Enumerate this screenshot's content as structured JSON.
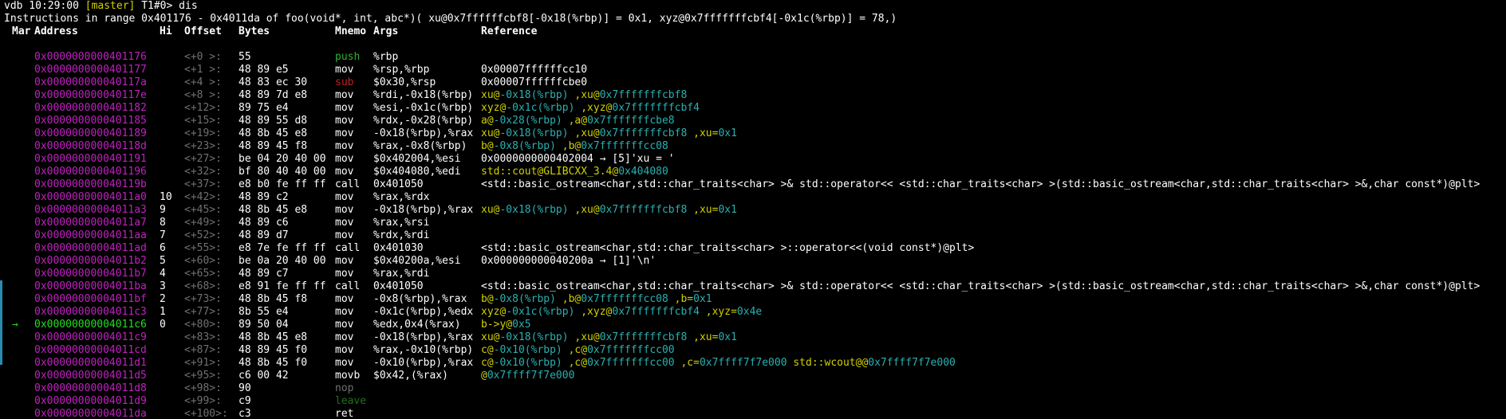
{
  "colors": {
    "background": "#000000",
    "address": "#c020c0",
    "current_address": "#22dd22",
    "offset": "#707070",
    "green_text": "#22b022",
    "cyan_text": "#2ab0b0",
    "yellow_text": "#d0d000",
    "jump_bar": "#2a8ab0"
  },
  "prompt": {
    "prefix": "vdb 10:29:00 ",
    "branch": "[master]",
    "suffix": " T1#0> ",
    "command": "dis"
  },
  "info_line": "Instructions in range 0x401176 - 0x4011da of foo(void*, int, abc*)( xu@0x7ffffffcbf8[-0x18(%rbp)] = 0x1, xyz@0x7fffffffcbf4[-0x1c(%rbp)] = 78,)",
  "columns": [
    "Mar",
    "Address",
    "Hi",
    "Offset",
    "Bytes",
    "Mnemo",
    "Args",
    "Reference"
  ],
  "rows": [
    {
      "mar": "",
      "addr": "0x0000000000401176",
      "hi": "",
      "off": "<+0 >:",
      "bytes": "55",
      "mn": "push",
      "mn_color": "green",
      "args": "%rbp",
      "ref": []
    },
    {
      "mar": "",
      "addr": "0x0000000000401177",
      "hi": "",
      "off": "<+1 >:",
      "bytes": "48 89 e5",
      "mn": "mov",
      "mn_color": "",
      "args": "%rsp,%rbp",
      "ref": [
        {
          "t": "0x00007ffffffcc10",
          "c": "dg"
        }
      ]
    },
    {
      "mar": "",
      "addr": "0x000000000040117a",
      "hi": "",
      "off": "<+4 >:",
      "bytes": "48 83 ec 30",
      "mn": "sub",
      "mn_color": "red",
      "args": "$0x30,%rsp",
      "ref": [
        {
          "t": "0x00007ffffffcbe0",
          "c": "dg"
        }
      ]
    },
    {
      "mar": "",
      "addr": "0x000000000040117e",
      "hi": "",
      "off": "<+8 >:",
      "bytes": "48 89 7d e8",
      "mn": "mov",
      "mn_color": "",
      "args": "%rdi,-0x18(%rbp)",
      "ref": [
        {
          "t": "xu@",
          "c": "ty"
        },
        {
          "t": "-0x18(%rbp)",
          "c": "tb"
        },
        {
          "t": " ,xu@",
          "c": "ty"
        },
        {
          "t": "0x7fffffffcbf8",
          "c": "tb"
        }
      ]
    },
    {
      "mar": "",
      "addr": "0x0000000000401182",
      "hi": "",
      "off": "<+12>:",
      "bytes": "89 75 e4",
      "mn": "mov",
      "mn_color": "",
      "args": "%esi,-0x1c(%rbp)",
      "ref": [
        {
          "t": "xyz@",
          "c": "ty"
        },
        {
          "t": "-0x1c(%rbp)",
          "c": "tb"
        },
        {
          "t": " ,xyz@",
          "c": "ty"
        },
        {
          "t": "0x7fffffffcbf4",
          "c": "tb"
        }
      ]
    },
    {
      "mar": "",
      "addr": "0x0000000000401185",
      "hi": "",
      "off": "<+15>:",
      "bytes": "48 89 55 d8",
      "mn": "mov",
      "mn_color": "",
      "args": "%rdx,-0x28(%rbp)",
      "ref": [
        {
          "t": "a@",
          "c": "ty"
        },
        {
          "t": "-0x28(%rbp)",
          "c": "tb"
        },
        {
          "t": " ,a@",
          "c": "ty"
        },
        {
          "t": "0x7fffffffcbe8",
          "c": "tb"
        }
      ]
    },
    {
      "mar": "",
      "addr": "0x0000000000401189",
      "hi": "",
      "off": "<+19>:",
      "bytes": "48 8b 45 e8",
      "mn": "mov",
      "mn_color": "",
      "args": "-0x18(%rbp),%rax",
      "ref": [
        {
          "t": "xu@",
          "c": "ty"
        },
        {
          "t": "-0x18(%rbp)",
          "c": "tb"
        },
        {
          "t": " ,xu@",
          "c": "ty"
        },
        {
          "t": "0x7fffffffcbf8",
          "c": "tb"
        },
        {
          "t": " ,xu=",
          "c": "ty"
        },
        {
          "t": "0x1",
          "c": "tb"
        }
      ]
    },
    {
      "mar": "",
      "addr": "0x000000000040118d",
      "hi": "",
      "off": "<+23>:",
      "bytes": "48 89 45 f8",
      "mn": "mov",
      "mn_color": "",
      "args": "%rax,-0x8(%rbp)",
      "ref": [
        {
          "t": "b@",
          "c": "ty"
        },
        {
          "t": "-0x8(%rbp)",
          "c": "tb"
        },
        {
          "t": " ,b@",
          "c": "ty"
        },
        {
          "t": "0x7fffffffcc08",
          "c": "tb"
        }
      ]
    },
    {
      "mar": "",
      "addr": "0x0000000000401191",
      "hi": "",
      "off": "<+27>:",
      "bytes": "be 04 20 40 00",
      "mn": "mov",
      "mn_color": "",
      "args": "$0x402004,%esi",
      "ref": [
        {
          "t": "0x0000000000402004 → [5]'xu = '",
          "c": "tw"
        }
      ]
    },
    {
      "mar": "",
      "addr": "0x0000000000401196",
      "hi": "",
      "off": "<+32>:",
      "bytes": "bf 80 40 40 00",
      "mn": "mov",
      "mn_color": "",
      "args": "$0x404080,%edi",
      "ref": [
        {
          "t": "std::cout@GLIBCXX_3.4@",
          "c": "ty"
        },
        {
          "t": "0x404080",
          "c": "tb"
        }
      ]
    },
    {
      "mar": "",
      "addr": "0x000000000040119b",
      "hi": "",
      "off": "<+37>:",
      "bytes": "e8 b0 fe ff ff",
      "mn": "call",
      "mn_color": "",
      "args": "0x401050",
      "ref": [
        {
          "t": "<std::basic_ostream<char,std::char_traits<char> >& std::operator<< <std::char_traits<char> >(std::basic_ostream<char,std::char_traits<char> >&,char const*)@plt>",
          "c": "tw"
        }
      ]
    },
    {
      "mar": "",
      "addr": "0x00000000004011a0",
      "hi": "10",
      "off": "<+42>:",
      "bytes": "48 89 c2",
      "mn": "mov",
      "mn_color": "",
      "args": "%rax,%rdx",
      "ref": []
    },
    {
      "mar": "",
      "addr": "0x00000000004011a3",
      "hi": "9",
      "off": "<+45>:",
      "bytes": "48 8b 45 e8",
      "mn": "mov",
      "mn_color": "",
      "args": "-0x18(%rbp),%rax",
      "ref": [
        {
          "t": "xu@",
          "c": "ty"
        },
        {
          "t": "-0x18(%rbp)",
          "c": "tb"
        },
        {
          "t": " ,xu@",
          "c": "ty"
        },
        {
          "t": "0x7fffffffcbf8",
          "c": "tb"
        },
        {
          "t": " ,xu=",
          "c": "ty"
        },
        {
          "t": "0x1",
          "c": "tb"
        }
      ]
    },
    {
      "mar": "",
      "addr": "0x00000000004011a7",
      "hi": "8",
      "off": "<+49>:",
      "bytes": "48 89 c6",
      "mn": "mov",
      "mn_color": "",
      "args": "%rax,%rsi",
      "ref": []
    },
    {
      "mar": "",
      "addr": "0x00000000004011aa",
      "hi": "7",
      "off": "<+52>:",
      "bytes": "48 89 d7",
      "mn": "mov",
      "mn_color": "",
      "args": "%rdx,%rdi",
      "ref": []
    },
    {
      "mar": "",
      "addr": "0x00000000004011ad",
      "hi": "6",
      "off": "<+55>:",
      "bytes": "e8 7e fe ff ff",
      "mn": "call",
      "mn_color": "",
      "args": "0x401030",
      "ref": [
        {
          "t": "<std::basic_ostream<char,std::char_traits<char> >::operator<<(void const*)@plt>",
          "c": "tw"
        }
      ]
    },
    {
      "mar": "",
      "addr": "0x00000000004011b2",
      "hi": "5",
      "off": "<+60>:",
      "bytes": "be 0a 20 40 00",
      "mn": "mov",
      "mn_color": "",
      "args": "$0x40200a,%esi",
      "ref": [
        {
          "t": "0x000000000040200a → [1]'\\n'",
          "c": "tw"
        }
      ]
    },
    {
      "mar": "",
      "addr": "0x00000000004011b7",
      "hi": "4",
      "off": "<+65>:",
      "bytes": "48 89 c7",
      "mn": "mov",
      "mn_color": "",
      "args": "%rax,%rdi",
      "ref": []
    },
    {
      "mar": "",
      "addr": "0x00000000004011ba",
      "hi": "3",
      "off": "<+68>:",
      "bytes": "e8 91 fe ff ff",
      "mn": "call",
      "mn_color": "",
      "args": "0x401050",
      "ref": [
        {
          "t": "<std::basic_ostream<char,std::char_traits<char> >& std::operator<< <std::char_traits<char> >(std::basic_ostream<char,std::char_traits<char> >&,char const*)@plt>",
          "c": "tw"
        }
      ]
    },
    {
      "mar": "",
      "addr": "0x00000000004011bf",
      "hi": "2",
      "off": "<+73>:",
      "bytes": "48 8b 45 f8",
      "mn": "mov",
      "mn_color": "",
      "args": "-0x8(%rbp),%rax",
      "ref": [
        {
          "t": "b@",
          "c": "ty"
        },
        {
          "t": "-0x8(%rbp)",
          "c": "tb"
        },
        {
          "t": " ,b@",
          "c": "ty"
        },
        {
          "t": "0x7fffffffcc08",
          "c": "tb"
        },
        {
          "t": " ,b=",
          "c": "ty"
        },
        {
          "t": "0x1",
          "c": "tb"
        }
      ]
    },
    {
      "mar": "",
      "addr": "0x00000000004011c3",
      "hi": "1",
      "off": "<+77>:",
      "bytes": "8b 55 e4",
      "mn": "mov",
      "mn_color": "",
      "args": "-0x1c(%rbp),%edx",
      "ref": [
        {
          "t": "xyz@",
          "c": "ty"
        },
        {
          "t": "-0x1c(%rbp)",
          "c": "tb"
        },
        {
          "t": " ,xyz@",
          "c": "ty"
        },
        {
          "t": "0x7fffffffcbf4",
          "c": "tb"
        },
        {
          "t": " ,xyz=",
          "c": "ty"
        },
        {
          "t": "0x4e",
          "c": "tb"
        }
      ]
    },
    {
      "mar": "→",
      "addr": "0x00000000004011c6",
      "hi": "0",
      "off": "<+80>:",
      "bytes": "89 50 04",
      "mn": "mov",
      "mn_color": "",
      "args": "%edx,0x4(%rax)",
      "current": true,
      "ref": [
        {
          "t": "b->y@",
          "c": "ty"
        },
        {
          "t": "0x5",
          "c": "tb"
        }
      ]
    },
    {
      "mar": "",
      "addr": "0x00000000004011c9",
      "hi": "",
      "off": "<+83>:",
      "bytes": "48 8b 45 e8",
      "mn": "mov",
      "mn_color": "",
      "args": "-0x18(%rbp),%rax",
      "ref": [
        {
          "t": "xu@",
          "c": "ty"
        },
        {
          "t": "-0x18(%rbp)",
          "c": "tb"
        },
        {
          "t": " ,xu@",
          "c": "ty"
        },
        {
          "t": "0x7fffffffcbf8",
          "c": "tb"
        },
        {
          "t": " ,xu=",
          "c": "ty"
        },
        {
          "t": "0x1",
          "c": "tb"
        }
      ]
    },
    {
      "mar": "",
      "addr": "0x00000000004011cd",
      "hi": "",
      "off": "<+87>:",
      "bytes": "48 89 45 f0",
      "mn": "mov",
      "mn_color": "",
      "args": "%rax,-0x10(%rbp)",
      "ref": [
        {
          "t": "c@",
          "c": "ty"
        },
        {
          "t": "-0x10(%rbp)",
          "c": "tb"
        },
        {
          "t": " ,c@",
          "c": "ty"
        },
        {
          "t": "0x7fffffffcc00",
          "c": "tb"
        }
      ]
    },
    {
      "mar": "",
      "addr": "0x00000000004011d1",
      "hi": "",
      "off": "<+91>:",
      "bytes": "48 8b 45 f0",
      "mn": "mov",
      "mn_color": "",
      "args": "-0x10(%rbp),%rax",
      "ref": [
        {
          "t": "c@",
          "c": "ty"
        },
        {
          "t": "-0x10(%rbp)",
          "c": "tb"
        },
        {
          "t": " ,c@",
          "c": "ty"
        },
        {
          "t": "0x7fffffffcc00",
          "c": "tb"
        },
        {
          "t": " ,c=",
          "c": "ty"
        },
        {
          "t": "0x7ffff7f7e000",
          "c": "tb"
        },
        {
          "t": " std::wcout@@",
          "c": "ty"
        },
        {
          "t": "0x7ffff7f7e000",
          "c": "tb"
        }
      ]
    },
    {
      "mar": "",
      "addr": "0x00000000004011d5",
      "hi": "",
      "off": "<+95>:",
      "bytes": "c6 00 42",
      "mn": "movb",
      "mn_color": "",
      "args": "$0x42,(%rax)",
      "ref": [
        {
          "t": "@",
          "c": "ty"
        },
        {
          "t": "0x7ffff7f7e000",
          "c": "tb"
        }
      ]
    },
    {
      "mar": "",
      "addr": "0x00000000004011d8",
      "hi": "",
      "off": "<+98>:",
      "bytes": "90",
      "mn": "nop",
      "mn_color": "grey",
      "args": "",
      "ref": []
    },
    {
      "mar": "",
      "addr": "0x00000000004011d9",
      "hi": "",
      "off": "<+99>:",
      "bytes": "c9",
      "mn": "leave",
      "mn_color": "dg",
      "args": "",
      "ref": []
    },
    {
      "mar": "",
      "addr": "0x00000000004011da",
      "hi": "",
      "off": "<+100>:",
      "bytes": "c3",
      "mn": "ret",
      "mn_color": "",
      "args": "",
      "ref": []
    }
  ]
}
